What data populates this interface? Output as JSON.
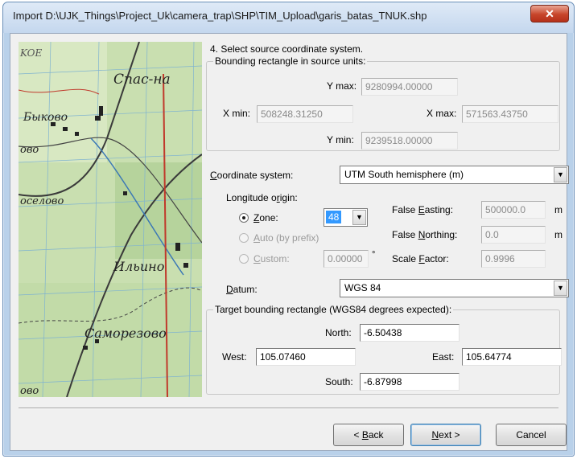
{
  "window": {
    "title": "Import D:\\UJK_Things\\Project_Uk\\camera_trap\\SHP\\TIM_Upload\\garis_batas_TNUK.shp",
    "close_glyph": "✕"
  },
  "map": {
    "labels": [
      "Спас-на",
      "Быково",
      "ово",
      "оселово",
      "Ильино",
      "Саморезово",
      "ово",
      "KOE"
    ]
  },
  "step": {
    "heading": "4. Select source coordinate system."
  },
  "source_bbox": {
    "title": "Bounding rectangle in source units:",
    "ymax_label": "Y max:",
    "ymax": "9280994.00000",
    "xmin_label": "X min:",
    "xmin": "508248.31250",
    "xmax_label": "X max:",
    "xmax": "571563.43750",
    "ymin_label": "Y min:",
    "ymin": "9239518.00000"
  },
  "coordinate_system": {
    "label_pre": "",
    "label_ul": "C",
    "label_post": "oordinate system:",
    "value": "UTM South hemisphere (m)"
  },
  "longitude_origin": {
    "label_pre": "Longitude o",
    "label_ul": "r",
    "label_post": "igin:",
    "zone_ul": "Z",
    "zone_rest": "one:",
    "zone_value": "48",
    "auto_ul": "A",
    "auto_rest": "uto (by prefix)",
    "custom_ul": "C",
    "custom_rest": "ustom:",
    "custom_value": "0.00000",
    "custom_unit": "°"
  },
  "params": {
    "false_easting_pre": "False ",
    "false_easting_ul": "E",
    "false_easting_post": "asting:",
    "false_easting": "500000.0",
    "false_easting_unit": "m",
    "false_northing_pre": "False ",
    "false_northing_ul": "N",
    "false_northing_post": "orthing:",
    "false_northing": "0.0",
    "false_northing_unit": "m",
    "scale_factor_pre": "Scale ",
    "scale_factor_ul": "F",
    "scale_factor_post": "actor:",
    "scale_factor": "0.9996"
  },
  "datum": {
    "label_ul": "D",
    "label_rest": "atum:",
    "value": "WGS 84"
  },
  "target_bbox": {
    "title": "Target bounding rectangle (WGS84 degrees expected):",
    "north_label": "North:",
    "north": "-6.50438",
    "west_label": "West:",
    "west": "105.07460",
    "east_label": "East:",
    "east": "105.64774",
    "south_label": "South:",
    "south": "-6.87998"
  },
  "buttons": {
    "back_pre": "< ",
    "back_ul": "B",
    "back_rest": "ack",
    "next_ul": "N",
    "next_rest": "ext >",
    "cancel": "Cancel"
  },
  "colors": {
    "title_bg": "#c4d7ee",
    "close": "#c7452a",
    "map_green": "#bfd7a6",
    "road_red": "#c0392b"
  }
}
